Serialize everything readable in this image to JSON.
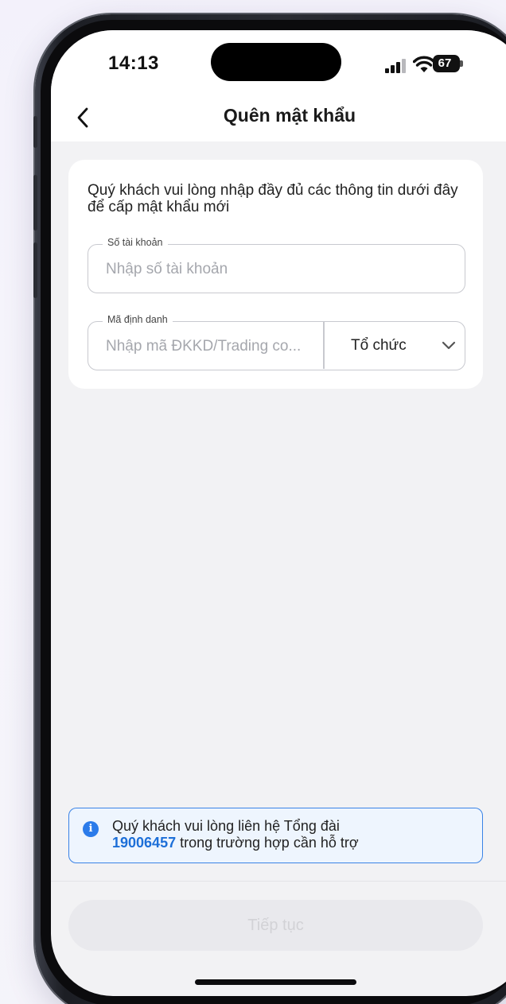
{
  "status_bar": {
    "time": "14:13",
    "battery": "67"
  },
  "header": {
    "title": "Quên mật khẩu",
    "back_icon": "chevron-left-icon"
  },
  "form": {
    "intro": "Quý khách vui lòng nhập đầy đủ các thông tin dưới đây để cấp mật khẩu mới",
    "account_field": {
      "label": "Số tài khoản",
      "placeholder": "Nhập số tài khoản",
      "value": ""
    },
    "id_field": {
      "label": "Mã định danh",
      "placeholder": "Nhập mã ĐKKD/Trading co...",
      "value": ""
    },
    "type_select": {
      "value": "Tổ chức",
      "icon": "chevron-down-icon"
    }
  },
  "info": {
    "icon": "info-icon",
    "text_before": "Quý khách vui lòng liên hệ Tổng đài",
    "hotline": "19006457",
    "text_after": " trong trường hợp cần hỗ trợ"
  },
  "footer": {
    "continue_label": "Tiếp tục"
  },
  "colors": {
    "accent": "#1d6fd8",
    "info_border": "#3a83e6",
    "info_background": "#eef5fe",
    "disabled_button": "#e9e9ed",
    "page_background": "#f2f2f4"
  }
}
